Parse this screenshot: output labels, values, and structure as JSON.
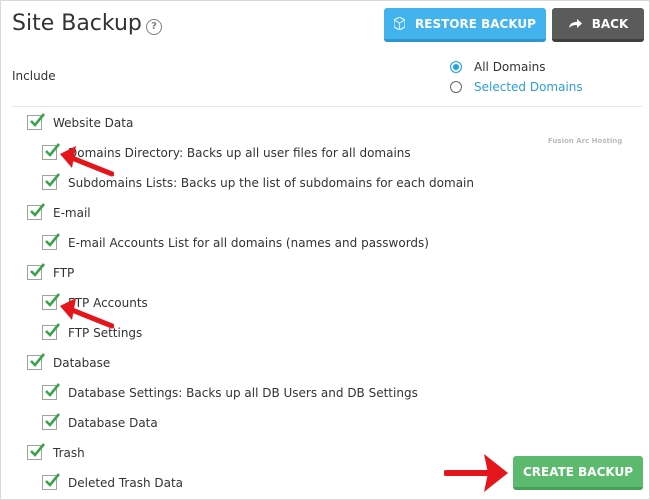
{
  "header": {
    "title": "Site Backup",
    "help_symbol": "?",
    "restore_label": "RESTORE BACKUP",
    "back_label": "BACK"
  },
  "include": {
    "label": "Include",
    "options": [
      {
        "label": "All Domains",
        "selected": true
      },
      {
        "label": "Selected Domains",
        "selected": false
      }
    ]
  },
  "watermark": "Fusion Arc Hosting",
  "sections": [
    {
      "label": "Website Data",
      "checked": true,
      "items": [
        {
          "label": "Domains Directory: Backs up all user files for all domains",
          "checked": true
        },
        {
          "label": "Subdomains Lists: Backs up the list of subdomains for each domain",
          "checked": true
        }
      ]
    },
    {
      "label": "E-mail",
      "checked": true,
      "items": [
        {
          "label": "E-mail Accounts List for all domains (names and passwords)",
          "checked": true
        }
      ]
    },
    {
      "label": "FTP",
      "checked": true,
      "items": [
        {
          "label": "FTP Accounts",
          "checked": true
        },
        {
          "label": "FTP Settings",
          "checked": true
        }
      ]
    },
    {
      "label": "Database",
      "checked": true,
      "items": [
        {
          "label": "Database Settings: Backs up all DB Users and DB Settings",
          "checked": true
        },
        {
          "label": "Database Data",
          "checked": true
        }
      ]
    },
    {
      "label": "Trash",
      "checked": true,
      "items": [
        {
          "label": "Deleted Trash Data",
          "checked": true
        }
      ]
    }
  ],
  "footer": {
    "create_label": "CREATE BACKUP"
  },
  "colors": {
    "restore_button": "#43b3ee",
    "back_button": "#5b5b5b",
    "create_button": "#5cba6f",
    "checkmark": "#3aa24b",
    "annotation_arrow": "#e5161b",
    "link": "#2d9fd9"
  }
}
